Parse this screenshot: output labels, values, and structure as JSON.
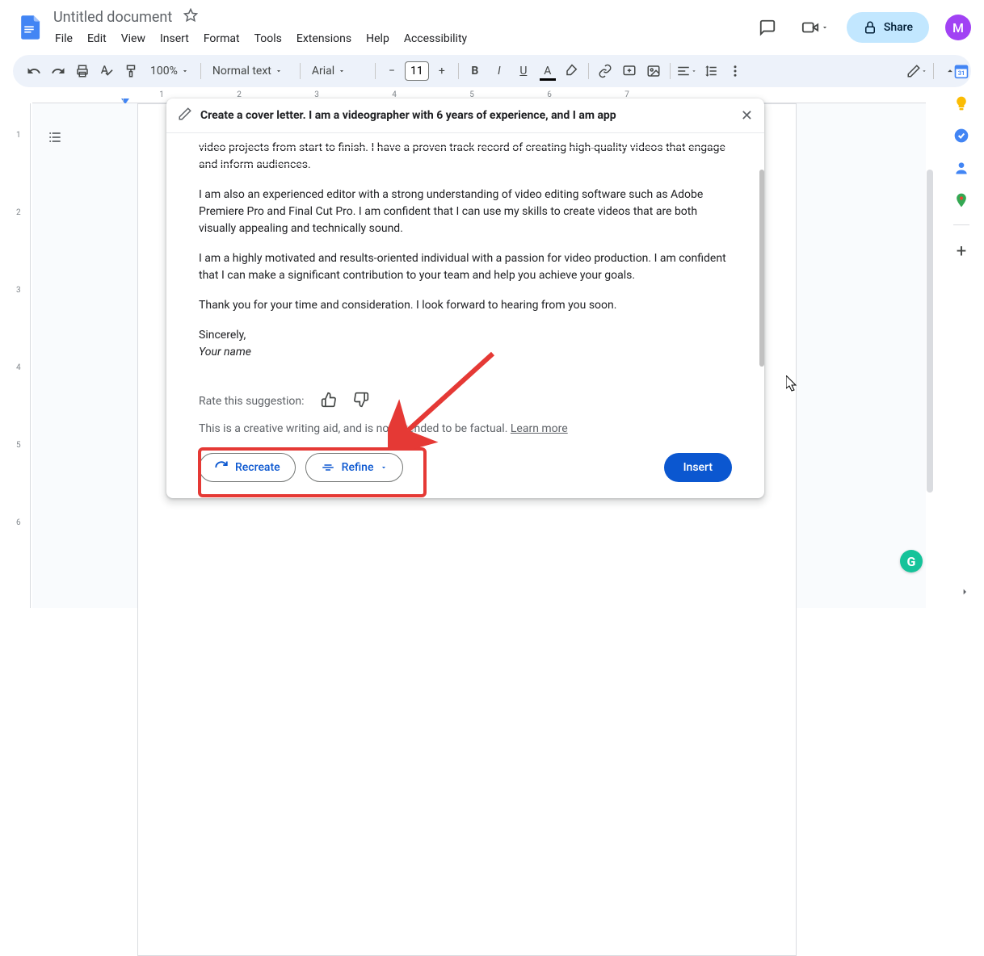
{
  "header": {
    "doc_title": "Untitled document",
    "menus": [
      "File",
      "Edit",
      "View",
      "Insert",
      "Format",
      "Tools",
      "Extensions",
      "Help",
      "Accessibility"
    ],
    "share_label": "Share",
    "avatar_letter": "M"
  },
  "toolbar": {
    "zoom": "100%",
    "style": "Normal text",
    "font": "Arial",
    "font_size": "11"
  },
  "ruler_h": [
    "1",
    "2",
    "3",
    "4",
    "5",
    "6",
    "7"
  ],
  "ruler_v": [
    "1",
    "2",
    "3",
    "4",
    "5",
    "6"
  ],
  "ai": {
    "prompt": "Create a cover letter. I am a videographer with 6 years of experience, and I am app",
    "paragraphs": [
      "video projects from start to finish. I have a proven track record of creating high-quality videos that engage and inform audiences.",
      "I am also an experienced editor with a strong understanding of video editing software such as Adobe Premiere Pro and Final Cut Pro. I am confident that I can use my skills to create videos that are both visually appealing and technically sound.",
      "I am a highly motivated and results-oriented individual with a passion for video production. I am confident that I can make a significant contribution to your team and help you achieve your goals.",
      "Thank you for your time and consideration. I look forward to hearing from you soon."
    ],
    "signoff": "Sincerely,",
    "signature": "Your name",
    "rate_label": "Rate this suggestion:",
    "disclaimer_pre": "This is a creative writing aid, and is not intended to be factual. ",
    "learn_more": "Learn more",
    "recreate": "Recreate",
    "refine": "Refine",
    "insert": "Insert"
  },
  "colors": {
    "brand_blue": "#0b57d0",
    "highlight_red": "#e53935"
  }
}
